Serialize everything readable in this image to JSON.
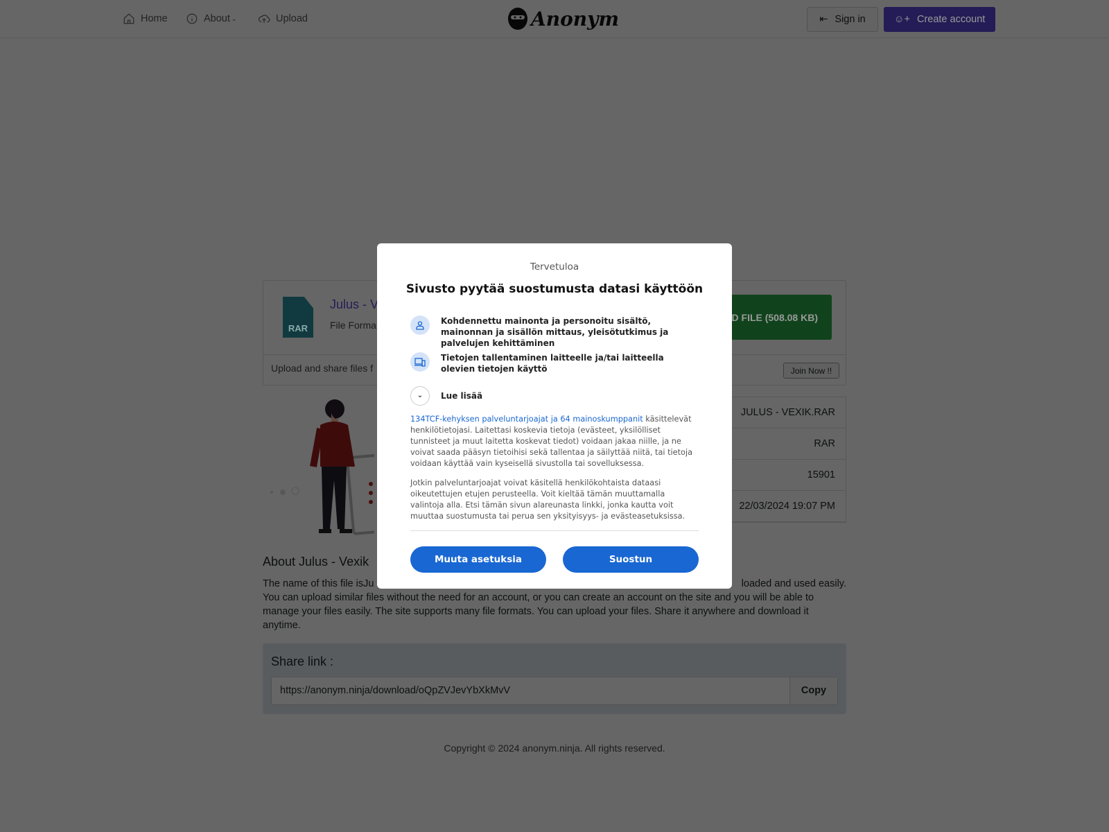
{
  "nav": {
    "home": "Home",
    "about": "About",
    "upload": "Upload",
    "logo": "Anonym",
    "sign_in": "Sign in",
    "create_account": "Create account"
  },
  "file": {
    "title_visible": "Julus - V",
    "format_visible": "File Forma",
    "icon_label": "RAR",
    "download_label": "D FILE (508.08 KB)",
    "promo_visible": "Upload and share files f",
    "join_now": "Join Now !!"
  },
  "details": {
    "values": [
      "JULUS - VEXIK.RAR",
      "RAR",
      "15901",
      "22/03/2024 19:07 PM"
    ]
  },
  "about": {
    "heading_visible": "About Julus - Vexik",
    "line1_start": "The name of this file isJu",
    "line1_end": "loaded and used easily.",
    "rest": "You can upload similar files without the need for an account, or you can create an account on the site and you will be able to manage your files easily. The site supports many file formats. You can upload your files. Share it anywhere and download it anytime."
  },
  "share": {
    "label": "Share link :",
    "url": "https://anonym.ninja/download/oQpZVJevYbXkMvV",
    "copy": "Copy"
  },
  "footer": "Copyright © 2024 anonym.ninja. All rights reserved.",
  "consent": {
    "welcome": "Tervetuloa",
    "title": "Sivusto pyytää suostumusta datasi käyttöön",
    "purposes": [
      "Kohdennettu mainonta ja personoitu sisältö, mainonnan ja sisällön mittaus, yleisötutkimus ja palvelujen kehittäminen",
      "Tietojen tallentaminen laitteelle ja/tai laitteella olevien tietojen käyttö"
    ],
    "read_more": "Lue lisää",
    "partners_link": "134TCF-kehyksen palveluntarjoajat ja 64 mainoskumppanit",
    "para1": " käsittelevät henkilötietojasi. Laitettasi koskevia tietoja (evästeet, yksilölliset tunnisteet ja muut laitetta koskevat tiedot) voidaan jakaa niille, ja ne voivat saada pääsyn tietoihisi sekä tallentaa ja säilyttää niitä, tai tietoja voidaan käyttää vain kyseisellä sivustolla tai sovelluksessa.",
    "para2": "Jotkin palveluntarjoajat voivat käsitellä henkilökohtaista dataasi oikeutettujen etujen perusteella. Voit kieltää tämän muuttamalla valintoja alla. Etsi tämän sivun alareunasta linkki, jonka kautta voit muuttaa suostumusta tai perua sen yksityisyys- ja evästeasetuksissa.",
    "manage": "Muuta asetuksia",
    "accept": "Suostun"
  },
  "colors": {
    "accent": "#5a46d8",
    "download": "#28a745",
    "consent_button": "#1967d2"
  }
}
